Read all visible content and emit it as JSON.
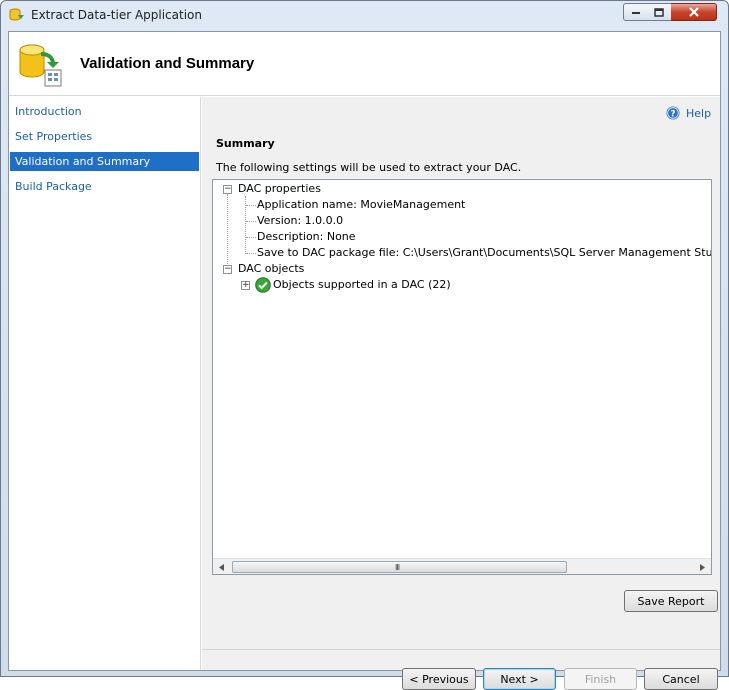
{
  "window": {
    "title": "Extract Data-tier Application",
    "title_icon": "dac-app-icon",
    "controls": [
      "minimize-icon",
      "maximize-icon",
      "close-icon"
    ]
  },
  "header": {
    "title": "Validation and Summary",
    "icon": "database-export-icon"
  },
  "nav": {
    "items": [
      {
        "label": "Introduction",
        "selected": false
      },
      {
        "label": "Set Properties",
        "selected": false
      },
      {
        "label": "Validation and Summary",
        "selected": true
      },
      {
        "label": "Build Package",
        "selected": false
      }
    ]
  },
  "main": {
    "help_label": "Help",
    "section_title": "Summary",
    "description": "The following settings will be used to extract your DAC.",
    "tree": {
      "dac_properties": {
        "label": "DAC properties",
        "children": [
          "Application name: MovieManagement",
          "Version: 1.0.0.0",
          "Description: None",
          "Save to DAC package file: C:\\Users\\Grant\\Documents\\SQL Server Management Studio\\DAC Packages\\MovieManagement.dacpac"
        ]
      },
      "dac_objects": {
        "label": "DAC objects",
        "children": [
          "Objects supported in a DAC (22)"
        ]
      }
    },
    "scrollbar_grip": "III",
    "save_report_label": "Save Report"
  },
  "footer": {
    "previous_label": "< Previous",
    "next_label": "Next >",
    "finish_label": "Finish",
    "cancel_label": "Cancel"
  },
  "colors": {
    "accent": "#1f6fc6",
    "link": "#1c5fa8",
    "success": "#3aa53a"
  }
}
